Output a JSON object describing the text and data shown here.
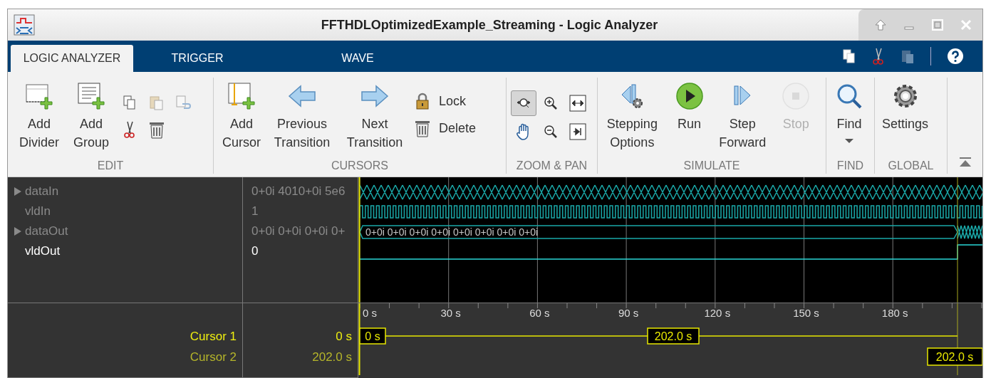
{
  "window": {
    "title": "FFTHDLOptimizedExample_Streaming - Logic Analyzer"
  },
  "tabs": [
    {
      "label": "LOGIC ANALYZER",
      "selected": true
    },
    {
      "label": "TRIGGER",
      "selected": false
    },
    {
      "label": "WAVE",
      "selected": false
    }
  ],
  "ribbon": {
    "edit": {
      "label": "EDIT",
      "buttons": [
        "Add Divider",
        "Add Group"
      ],
      "tools": [
        {
          "disabled": false
        },
        {
          "disabled": true
        },
        {
          "disabled": true
        },
        {
          "disabled": false
        },
        {
          "disabled": false
        }
      ]
    },
    "cursors": {
      "label": "CURSORS",
      "buttons": [
        "Add Cursor",
        "Previous Transition",
        "Next Transition"
      ],
      "lock": "Lock",
      "delete": "Delete"
    },
    "zoom_pan": {
      "label": "ZOOM & PAN",
      "tools": [
        {
          "selected": true
        },
        {
          "selected": false
        },
        {
          "selected": false
        },
        {
          "selected": false
        },
        {
          "selected": false
        },
        {
          "selected": false
        }
      ]
    },
    "simulate": {
      "label": "SIMULATE",
      "buttons": [
        {
          "label": "Stepping Options",
          "disabled": false
        },
        {
          "label": "Run",
          "disabled": false
        },
        {
          "label": "Step Forward",
          "disabled": false
        },
        {
          "label": "Stop",
          "disabled": true
        }
      ]
    },
    "find": {
      "label": "FIND",
      "button": "Find"
    },
    "global": {
      "label": "GLOBAL",
      "button": "Settings"
    }
  },
  "signals": [
    {
      "name": "dataIn",
      "value": "0+0i 4010+0i 5e6",
      "expandable": true,
      "selected": false,
      "kind": "dense-bus"
    },
    {
      "name": "vldIn",
      "value": "1",
      "expandable": false,
      "selected": false,
      "kind": "clock"
    },
    {
      "name": "dataOut",
      "value": "0+0i 0+0i 0+0i 0+",
      "expandable": true,
      "selected": false,
      "kind": "labeled-bus",
      "bus_text": "0+0i 0+0i 0+0i 0+0i 0+0i 0+0i 0+0i 0+0i"
    },
    {
      "name": "vldOut",
      "value": "0",
      "expandable": false,
      "selected": true,
      "kind": "step"
    }
  ],
  "time_axis": {
    "ticks": [
      "0 s",
      "30 s",
      "60 s",
      "90 s",
      "120 s",
      "150 s",
      "180 s"
    ]
  },
  "cursors": [
    {
      "name": "Cursor 1",
      "value": "0 s",
      "flag": "0 s",
      "selected": true
    },
    {
      "name": "Cursor 2",
      "value": "202.0 s",
      "flag": "202.0 s",
      "selected": false
    }
  ],
  "cursor_delta": "202.0 s"
}
